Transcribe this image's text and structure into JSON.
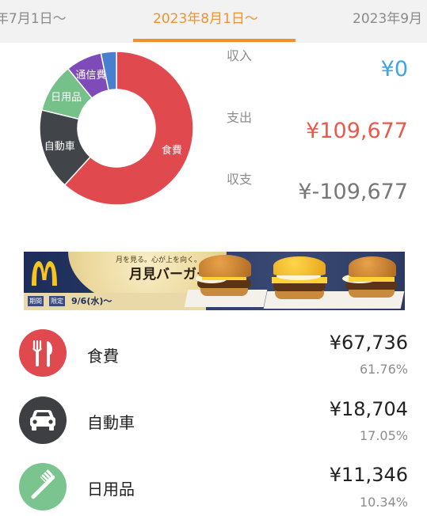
{
  "tabs": {
    "prev": "年7月1日～",
    "current": "2023年8月1日～",
    "next": "2023年9月"
  },
  "summary": {
    "income_label": "収入",
    "income_value": "¥0",
    "expense_label": "支出",
    "expense_value": "¥109,677",
    "balance_label": "収支",
    "balance_value": "¥-109,677"
  },
  "chart_data": {
    "type": "pie",
    "title": "",
    "slices": [
      {
        "label": "食費",
        "value": 61.76,
        "color": "#e04a4f"
      },
      {
        "label": "自動車",
        "value": 17.05,
        "color": "#414449"
      },
      {
        "label": "日用品",
        "value": 10.34,
        "color": "#76c08a"
      },
      {
        "label": "通信費",
        "value": 7.6,
        "color": "#7e4bb8"
      },
      {
        "label": "",
        "value": 3.25,
        "color": "#4a7fd0"
      }
    ]
  },
  "ad": {
    "title_small": "月を見る。心が上を向く。",
    "title_big": "月見バーガー",
    "period_badge": "期間",
    "limited_badge": "限定",
    "date": "9/6(水)～"
  },
  "categories": [
    {
      "name": "食費",
      "amount": "¥67,736",
      "percent": "61.76%",
      "icon": "fork-knife-icon",
      "color": "#e04a4f"
    },
    {
      "name": "自動車",
      "amount": "¥18,704",
      "percent": "17.05%",
      "icon": "car-icon",
      "color": "#3d3f43"
    },
    {
      "name": "日用品",
      "amount": "¥11,346",
      "percent": "10.34%",
      "icon": "toothbrush-icon",
      "color": "#7cc48f"
    }
  ]
}
